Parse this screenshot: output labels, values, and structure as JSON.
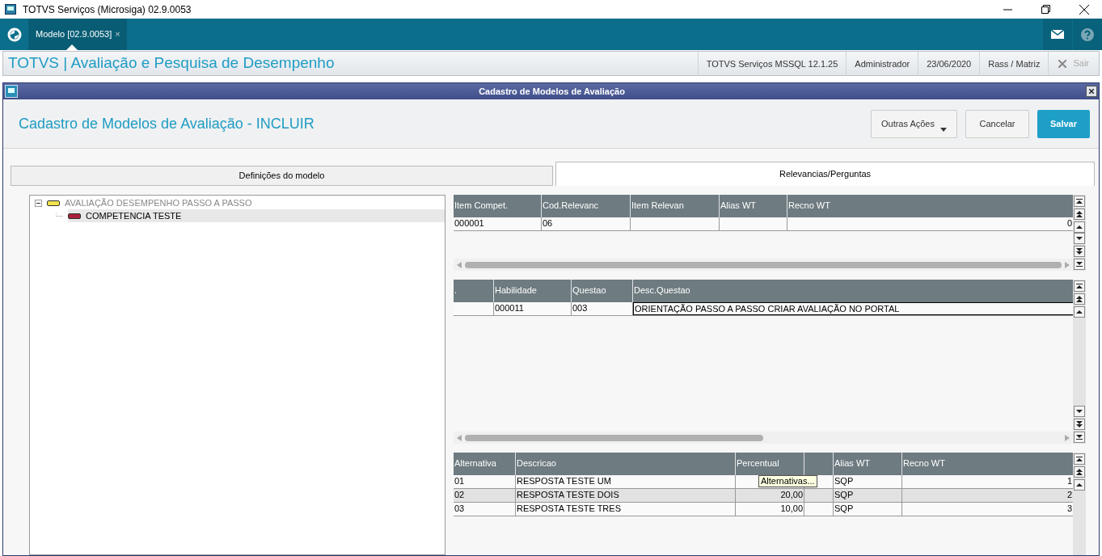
{
  "window": {
    "title": "TOTVS Serviços (Microsiga) 02.9.0053"
  },
  "app_tabs": [
    {
      "label": "Modelo [02.9.0053]",
      "close": "×",
      "selected": true
    }
  ],
  "header": {
    "title": "TOTVS | Avaliação e Pesquisa de Desempenho",
    "info": [
      "TOTVS Serviços MSSQL 12.1.25",
      "Administrador",
      "23/06/2020",
      "Rass / Matriz"
    ],
    "exit": "Sair"
  },
  "dialog": {
    "title": "Cadastro de Modelos de Avaliação",
    "heading": "Cadastro de Modelos de Avaliação - INCLUIR",
    "buttons": [
      {
        "label": "Outras Ações",
        "kind": "menu"
      },
      {
        "label": "Cancelar",
        "kind": "normal"
      },
      {
        "label": "Salvar",
        "kind": "primary"
      }
    ],
    "tabs": [
      {
        "label": "Definições do modelo",
        "selected": false
      },
      {
        "label": "Relevancias/Perguntas",
        "selected": true
      }
    ],
    "tree": [
      {
        "label": "AVALIAÇÃO DESEMPENHO PASSO A PASSO",
        "color": "#f2e24a",
        "expanded": true,
        "selected": false,
        "children": [
          {
            "label": "COMPETENCIA TESTE",
            "color": "#a8213c",
            "selected": true
          }
        ]
      }
    ],
    "grids": [
      {
        "columns": [
          {
            "label": "Item Compet.",
            "kind": "text"
          },
          {
            "label": "Cod.Relevanc",
            "kind": "text"
          },
          {
            "label": "Item Relevan",
            "kind": "text"
          },
          {
            "label": "Alias WT",
            "kind": "text"
          },
          {
            "label": "Recno WT",
            "kind": "number"
          }
        ],
        "rows": [
          {
            "cells": [
              "000001",
              "06",
              null,
              null,
              "0"
            ],
            "selected": false,
            "editing": false
          }
        ],
        "hscroll": true
      },
      {
        "columns": [
          {
            "label": ".",
            "kind": "text"
          },
          {
            "label": "Habilidade",
            "kind": "text"
          },
          {
            "label": "Questao",
            "kind": "text"
          },
          {
            "label": "Desc.Questao",
            "kind": "text"
          }
        ],
        "rows": [
          {
            "cells": [
              null,
              "000011",
              "003",
              "ORIENTAÇÃO PASSO A PASSO CRIAR AVALIAÇÃO NO PORTAL"
            ],
            "selected": false,
            "editing": true
          }
        ],
        "hscroll": true
      },
      {
        "columns": [
          {
            "label": "Alternativa",
            "kind": "text"
          },
          {
            "label": "Descricao",
            "kind": "text"
          },
          {
            "label": "Percentual",
            "kind": "number"
          },
          {
            "kind": "text"
          },
          {
            "label": "Alias WT",
            "kind": "text"
          },
          {
            "label": "Recno WT",
            "kind": "number"
          }
        ],
        "rows": [
          {
            "cells": [
              "01",
              "RESPOSTA TESTE UM",
              null,
              null,
              "SQP",
              "1"
            ],
            "selected": false,
            "editing": false
          },
          {
            "cells": [
              "02",
              "RESPOSTA TESTE DOIS",
              "20,00",
              null,
              "SQP",
              "2"
            ],
            "selected": true,
            "editing": false
          },
          {
            "cells": [
              "03",
              "RESPOSTA TESTE TRES",
              "10,00",
              null,
              "SQP",
              "3"
            ],
            "selected": false,
            "editing": false
          }
        ],
        "hscroll": false,
        "tooltip": "Alternativas..."
      }
    ]
  }
}
